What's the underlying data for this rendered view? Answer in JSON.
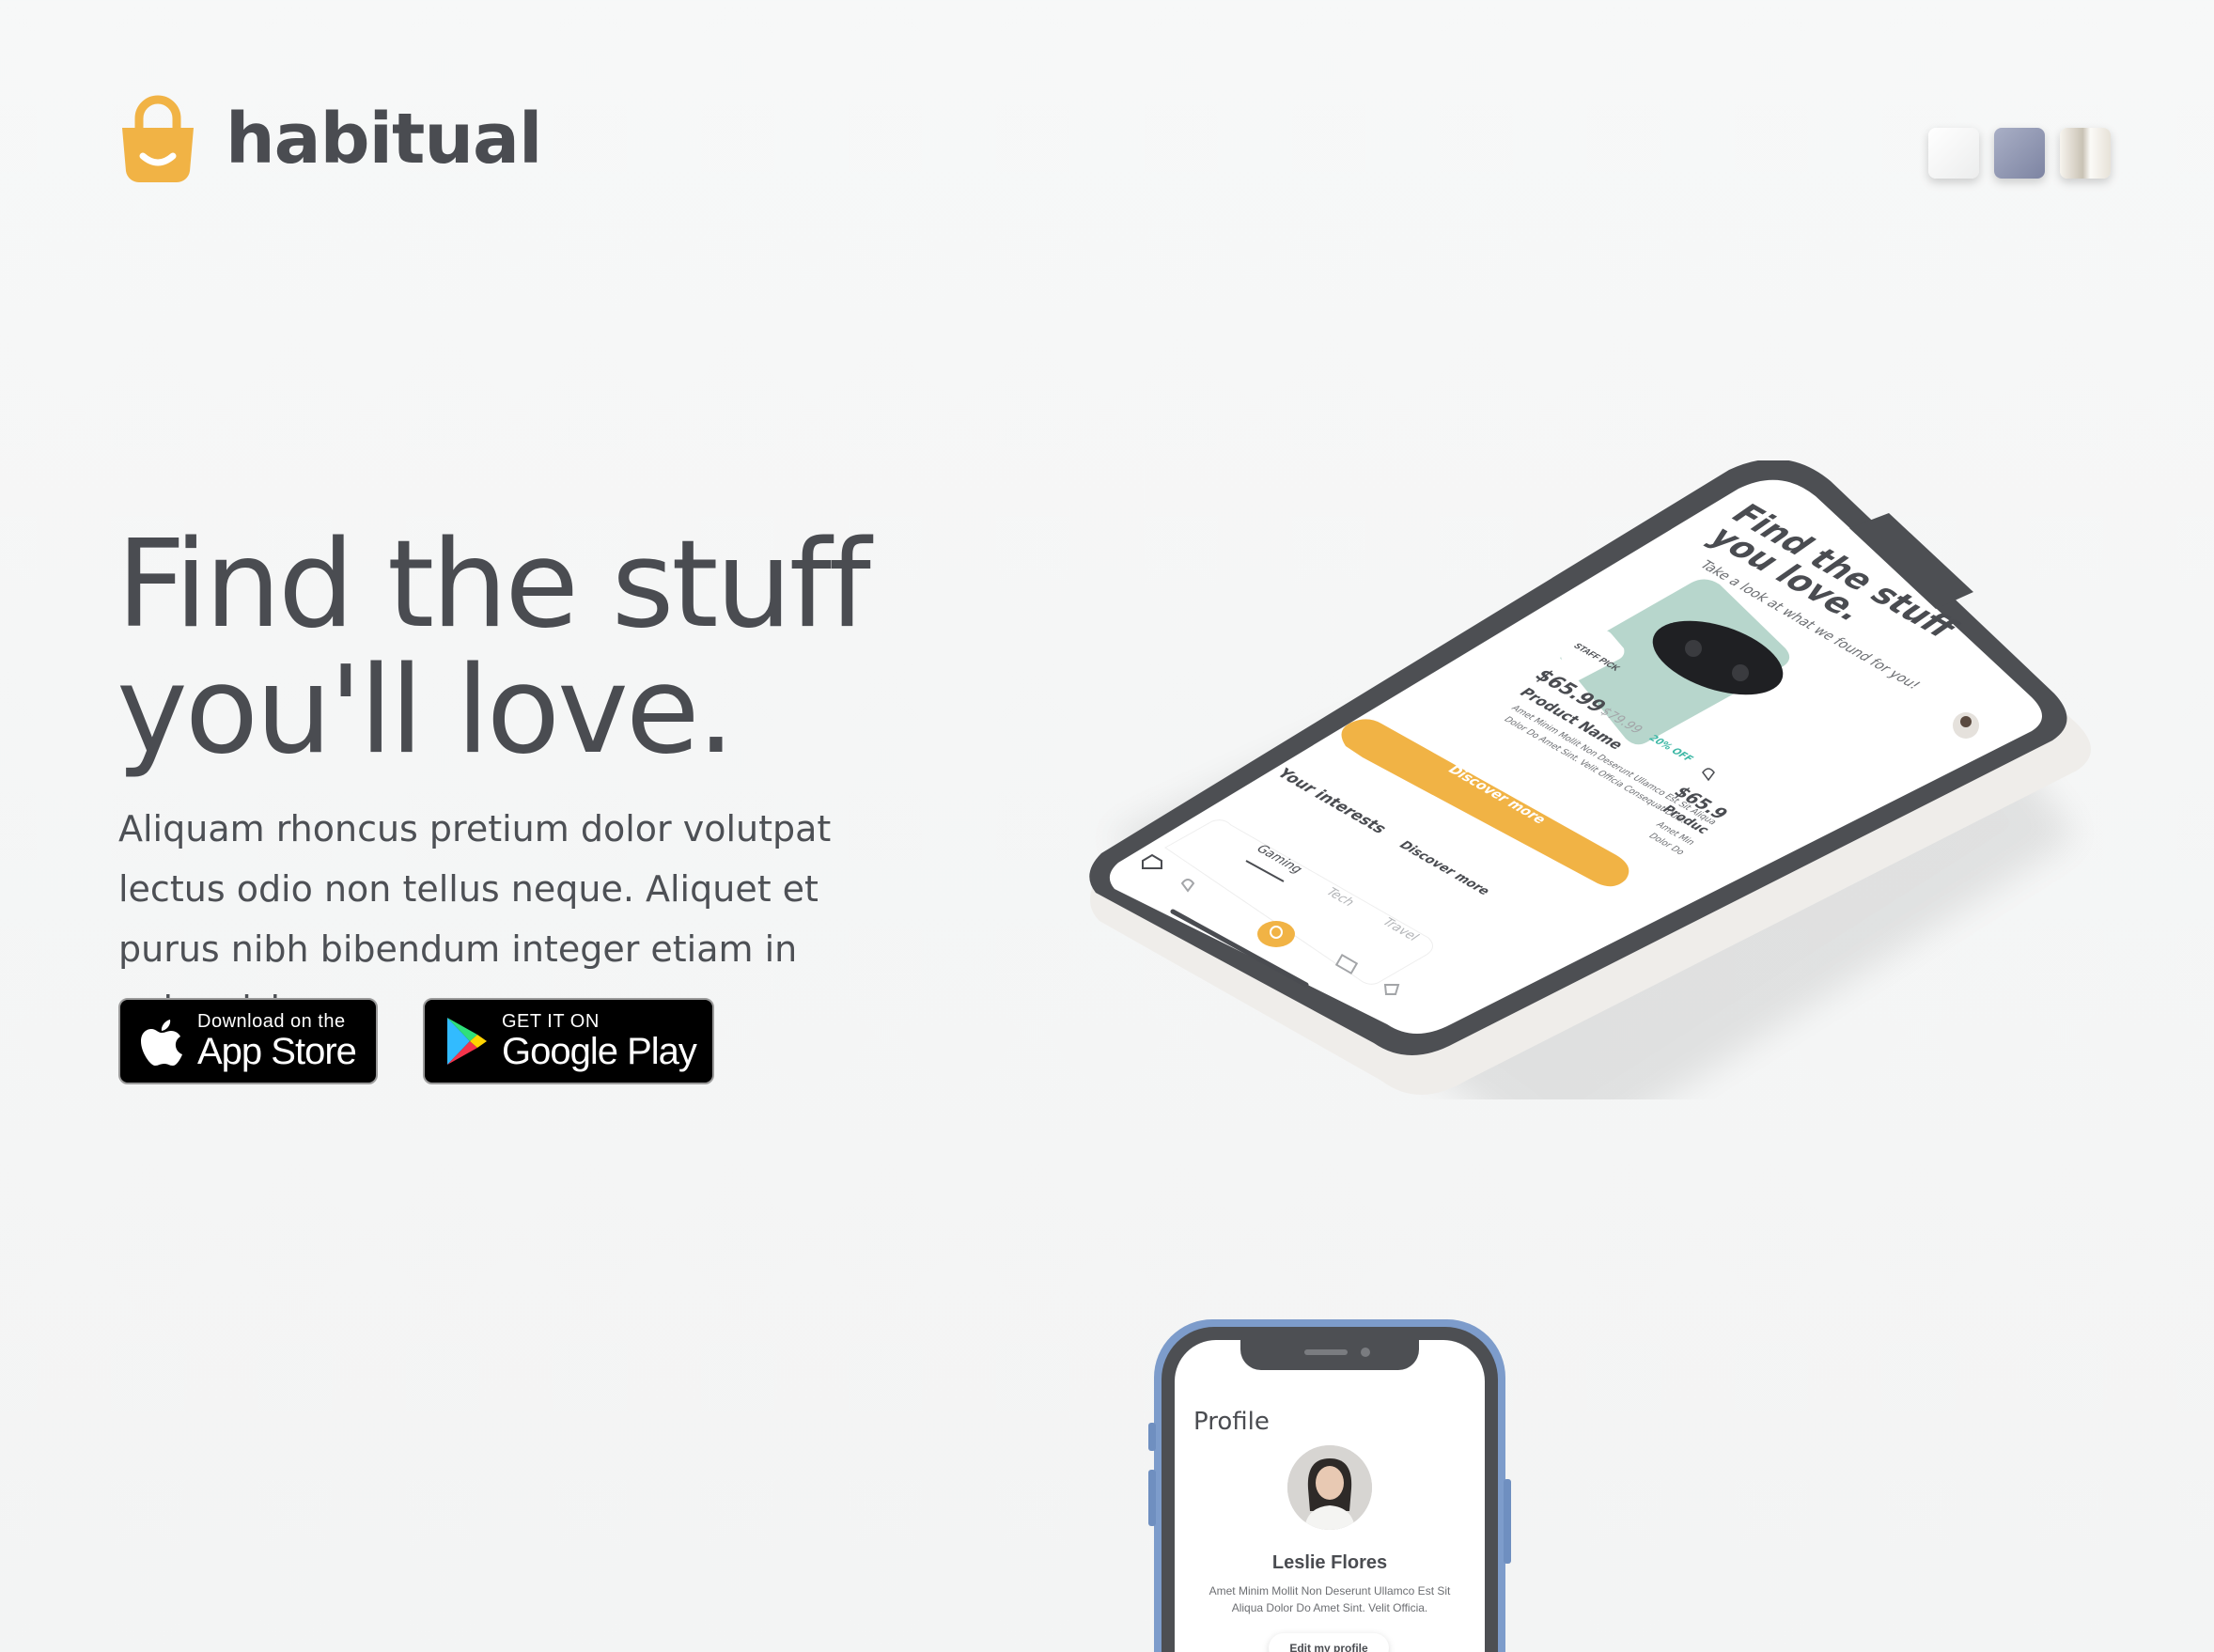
{
  "brand": {
    "name": "habitual",
    "logo_icon": "shopping-bag-smile-icon",
    "accent_color": "#f1b345"
  },
  "color_swatches": [
    {
      "name": "white",
      "color": "#f3f4f4"
    },
    {
      "name": "blue",
      "color": "#8f96b2"
    },
    {
      "name": "gold",
      "color": "#e1dbd0"
    }
  ],
  "hero": {
    "title_line1": "Find the stuff",
    "title_line2": "you'll love.",
    "body": "Aliquam rhoncus pretium dolor volutpat lectus odio non tellus neque. Aliquet et purus nibh bibendum integer etiam in enim nisi."
  },
  "badges": {
    "apple": {
      "small": "Download on the",
      "big": "App Store"
    },
    "google": {
      "small": "GET IT ON",
      "big": "Google Play"
    }
  },
  "phone_main": {
    "title_line1": "Find the stuff",
    "title_line2": "you love.",
    "subtitle": "Take a look at what we found for you!",
    "staff_pick": "STAFF PICK",
    "price": "$65.99",
    "old_price": "$79.99",
    "discount": "20% OFF",
    "product_name": "Product Name",
    "product_desc_line1": "Amet Minim Mollit Non Deserunt Ullamco Est Sit Aliqua",
    "product_desc_line2": "Dolor Do Amet Sint. Velit Officia Consequat Duis.",
    "cta": "Discover more",
    "second_price": "$65.9",
    "second_name": "Produc",
    "second_desc_1": "Amet Min",
    "second_desc_2": "Dolor Do",
    "interests_title": "Your interests",
    "interests_link": "Discover more",
    "interests": [
      "Gaming",
      "Tech",
      "Travel"
    ],
    "nav_icons": [
      "home-icon",
      "heart-icon",
      "search-icon",
      "list-icon",
      "cart-icon"
    ]
  },
  "phone_profile": {
    "title": "Profile",
    "name": "Leslie Flores",
    "description_line1": "Amet Minim Mollit Non Deserunt Ullamco Est Sit",
    "description_line2": "Aliqua Dolor Do Amet Sint. Velit Officia.",
    "edit_button": "Edit my profile"
  }
}
